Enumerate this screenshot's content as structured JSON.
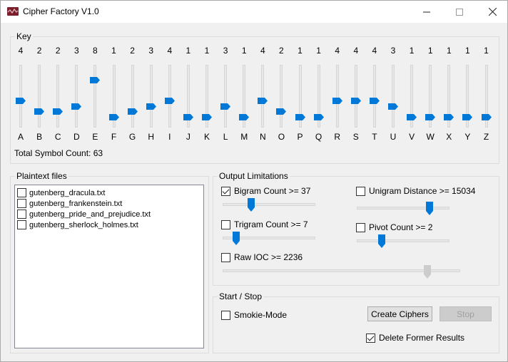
{
  "window": {
    "title": "Cipher Factory V1.0",
    "minimize_glyph": "—",
    "maximize_glyph": "☐",
    "close_glyph": "✕"
  },
  "key": {
    "label": "Key",
    "columns": [
      {
        "letter": "A",
        "count": "4"
      },
      {
        "letter": "B",
        "count": "2"
      },
      {
        "letter": "C",
        "count": "2"
      },
      {
        "letter": "D",
        "count": "3"
      },
      {
        "letter": "E",
        "count": "8"
      },
      {
        "letter": "F",
        "count": "1"
      },
      {
        "letter": "G",
        "count": "2"
      },
      {
        "letter": "H",
        "count": "3"
      },
      {
        "letter": "I",
        "count": "4"
      },
      {
        "letter": "J",
        "count": "1"
      },
      {
        "letter": "K",
        "count": "1"
      },
      {
        "letter": "L",
        "count": "3"
      },
      {
        "letter": "M",
        "count": "1"
      },
      {
        "letter": "N",
        "count": "4"
      },
      {
        "letter": "O",
        "count": "2"
      },
      {
        "letter": "P",
        "count": "1"
      },
      {
        "letter": "Q",
        "count": "1"
      },
      {
        "letter": "R",
        "count": "4"
      },
      {
        "letter": "S",
        "count": "4"
      },
      {
        "letter": "T",
        "count": "4"
      },
      {
        "letter": "U",
        "count": "3"
      },
      {
        "letter": "V",
        "count": "1"
      },
      {
        "letter": "W",
        "count": "1"
      },
      {
        "letter": "X",
        "count": "1"
      },
      {
        "letter": "Y",
        "count": "1"
      },
      {
        "letter": "Z",
        "count": "1"
      }
    ],
    "slider_max": 10,
    "total_label": "Total Symbol Count: 63",
    "accent": "#0078d7"
  },
  "plaintext": {
    "label": "Plaintext files",
    "items": [
      {
        "name": "gutenberg_dracula.txt",
        "checked": false
      },
      {
        "name": "gutenberg_frankenstein.txt",
        "checked": false
      },
      {
        "name": "gutenberg_pride_and_prejudice.txt",
        "checked": false
      },
      {
        "name": "gutenberg_sherlock_holmes.txt",
        "checked": false
      }
    ]
  },
  "output": {
    "label": "Output Limitations",
    "bigram": {
      "label": "Bigram Count >= 37",
      "checked": true,
      "level": 0.3
    },
    "trigram": {
      "label": "Trigram Count >= 7",
      "checked": false,
      "level": 0.15
    },
    "raw_ioc": {
      "label": "Raw IOC >= 2236",
      "checked": false,
      "level": 0.85,
      "disabled": true
    },
    "unigram": {
      "label": "Unigram Distance >= 15034",
      "checked": false,
      "level": 0.78
    },
    "pivot": {
      "label": "Pivot Count >= 2",
      "checked": false,
      "level": 0.25
    }
  },
  "startstop": {
    "label": "Start / Stop",
    "smokie": {
      "label": "Smokie-Mode",
      "checked": false
    },
    "create_label": "Create Ciphers",
    "stop_label": "Stop",
    "delete": {
      "label": "Delete Former Results",
      "checked": true
    }
  }
}
